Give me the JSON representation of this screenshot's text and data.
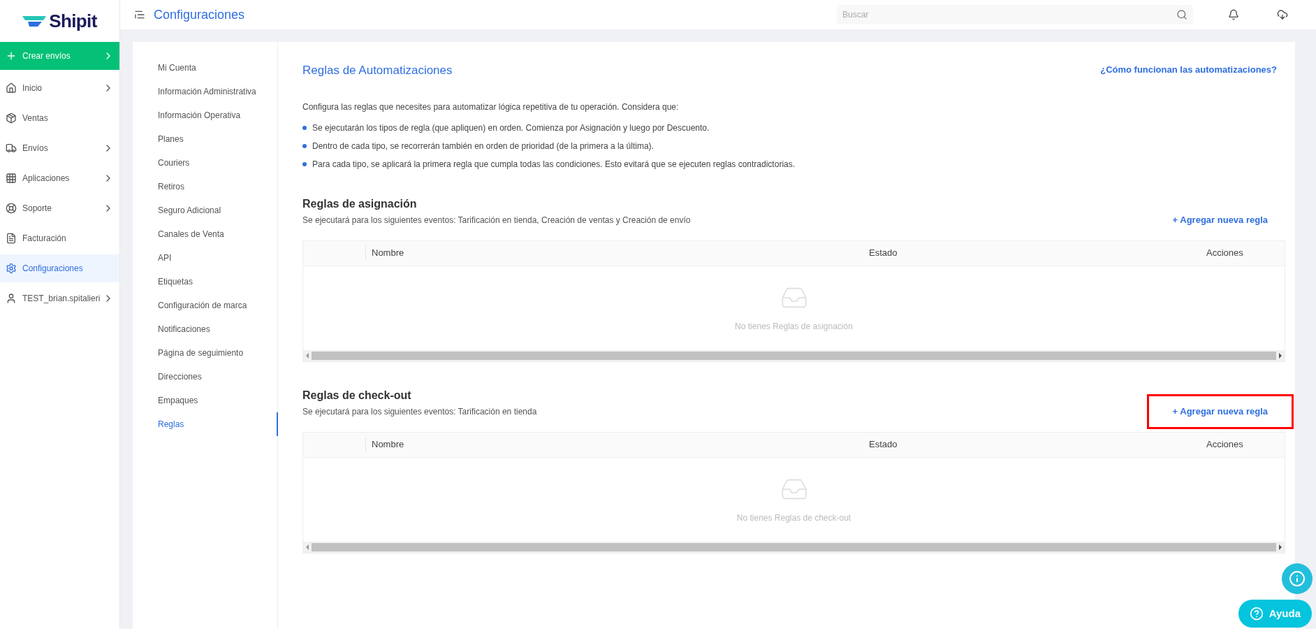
{
  "brand": {
    "name": "Shipit"
  },
  "sidebar": {
    "items": [
      {
        "label": "Crear envíos",
        "kind": "action",
        "chevron": true,
        "selected": false
      },
      {
        "label": "Inicio",
        "kind": "nav",
        "chevron": true,
        "selected": false
      },
      {
        "label": "Ventas",
        "kind": "nav",
        "chevron": false,
        "selected": false
      },
      {
        "label": "Envíos",
        "kind": "nav",
        "chevron": true,
        "selected": false
      },
      {
        "label": "Aplicaciones",
        "kind": "nav",
        "chevron": true,
        "selected": false
      },
      {
        "label": "Soporte",
        "kind": "nav",
        "chevron": true,
        "selected": false
      },
      {
        "label": "Facturación",
        "kind": "nav",
        "chevron": false,
        "selected": false
      },
      {
        "label": "Configuraciones",
        "kind": "nav",
        "chevron": false,
        "selected": true
      },
      {
        "label": "TEST_brian.spitalieri",
        "kind": "nav",
        "chevron": true,
        "selected": false
      }
    ]
  },
  "header": {
    "title": "Configuraciones",
    "search": {
      "placeholder": "Buscar"
    }
  },
  "settings_menu": {
    "items": [
      {
        "label": "Mi Cuenta",
        "selected": false
      },
      {
        "label": "Información Administrativa",
        "selected": false
      },
      {
        "label": "Información Operativa",
        "selected": false
      },
      {
        "label": "Planes",
        "selected": false
      },
      {
        "label": "Couriers",
        "selected": false
      },
      {
        "label": "Retiros",
        "selected": false
      },
      {
        "label": "Seguro Adicional",
        "selected": false
      },
      {
        "label": "Canales de Venta",
        "selected": false
      },
      {
        "label": "API",
        "selected": false
      },
      {
        "label": "Etiquetas",
        "selected": false
      },
      {
        "label": "Configuración de marca",
        "selected": false
      },
      {
        "label": "Notificaciones",
        "selected": false
      },
      {
        "label": "Página de seguimiento",
        "selected": false
      },
      {
        "label": "Direcciones",
        "selected": false
      },
      {
        "label": "Empaques",
        "selected": false
      },
      {
        "label": "Reglas",
        "selected": true
      }
    ]
  },
  "content": {
    "title": "Reglas de Automatizaciones",
    "help_link": "¿Cómo funcionan las automatizaciones?",
    "intro": "Configura las reglas que necesites para automatizar lógica repetitiva de tu operación. Considera que:",
    "bullets": [
      "Se ejecutarán los tipos de regla (que apliquen) en orden. Comienza por Asignación y luego por Descuento.",
      "Dentro de cada tipo, se recorrerán también en orden de prioridad (de la primera a la última).",
      "Para cada tipo, se aplicará la primera regla que cumpla todas las condiciones. Esto evitará que se ejecuten reglas contradictorias."
    ],
    "sections": [
      {
        "title": "Reglas de asignación",
        "subtitle": "Se ejecutará para los siguientes eventos: Tarificación en tienda, Creación de ventas y Creación de envío",
        "add_button": "+ Agregar nueva regla",
        "highlighted": false,
        "columns": [
          "Nombre",
          "Estado",
          "Acciones"
        ],
        "empty_text": "No tienes Reglas de asignación"
      },
      {
        "title": "Reglas de check-out",
        "subtitle": "Se ejecutará para los siguientes eventos: Tarificación en tienda",
        "add_button": "+ Agregar nueva regla",
        "highlighted": true,
        "columns": [
          "Nombre",
          "Estado",
          "Acciones"
        ],
        "empty_text": "No tienes Reglas de check-out"
      }
    ]
  },
  "help_button": {
    "label": "Ayuda"
  }
}
